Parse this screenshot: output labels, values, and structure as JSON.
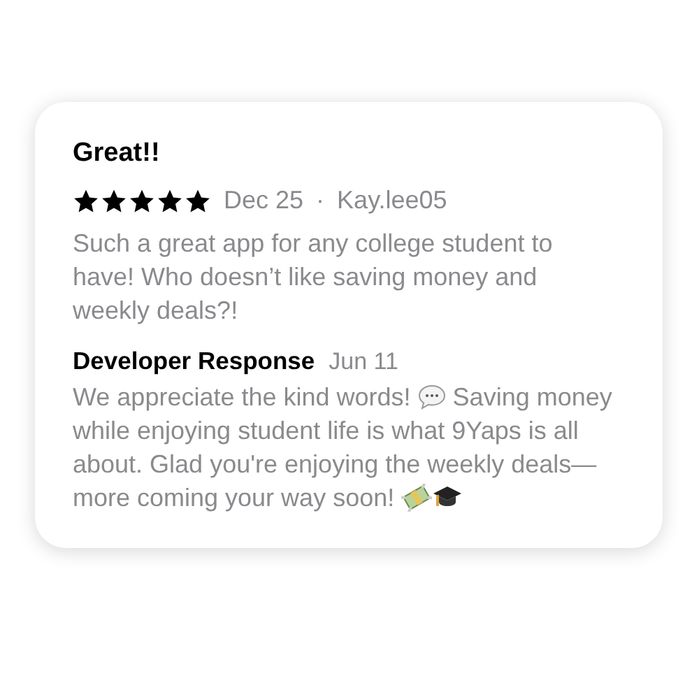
{
  "review": {
    "title": "Great!!",
    "stars": 5,
    "date": "Dec 25",
    "separator": "·",
    "author": "Kay.lee05",
    "body": "Such a great app for any college student to have! Who doesn’t like saving money and weekly deals?!"
  },
  "developer_response": {
    "heading": "Developer Response",
    "date": "Jun 11",
    "parts": [
      {
        "kind": "text",
        "text": "We appreciate the kind words! "
      },
      {
        "kind": "speech"
      },
      {
        "kind": "text",
        "text": " Saving money while enjoying student life is what 9Yaps is all about. Glad you're enjoying the weekly deals—more coming your way soon! "
      },
      {
        "kind": "money"
      },
      {
        "kind": "cap"
      }
    ]
  }
}
